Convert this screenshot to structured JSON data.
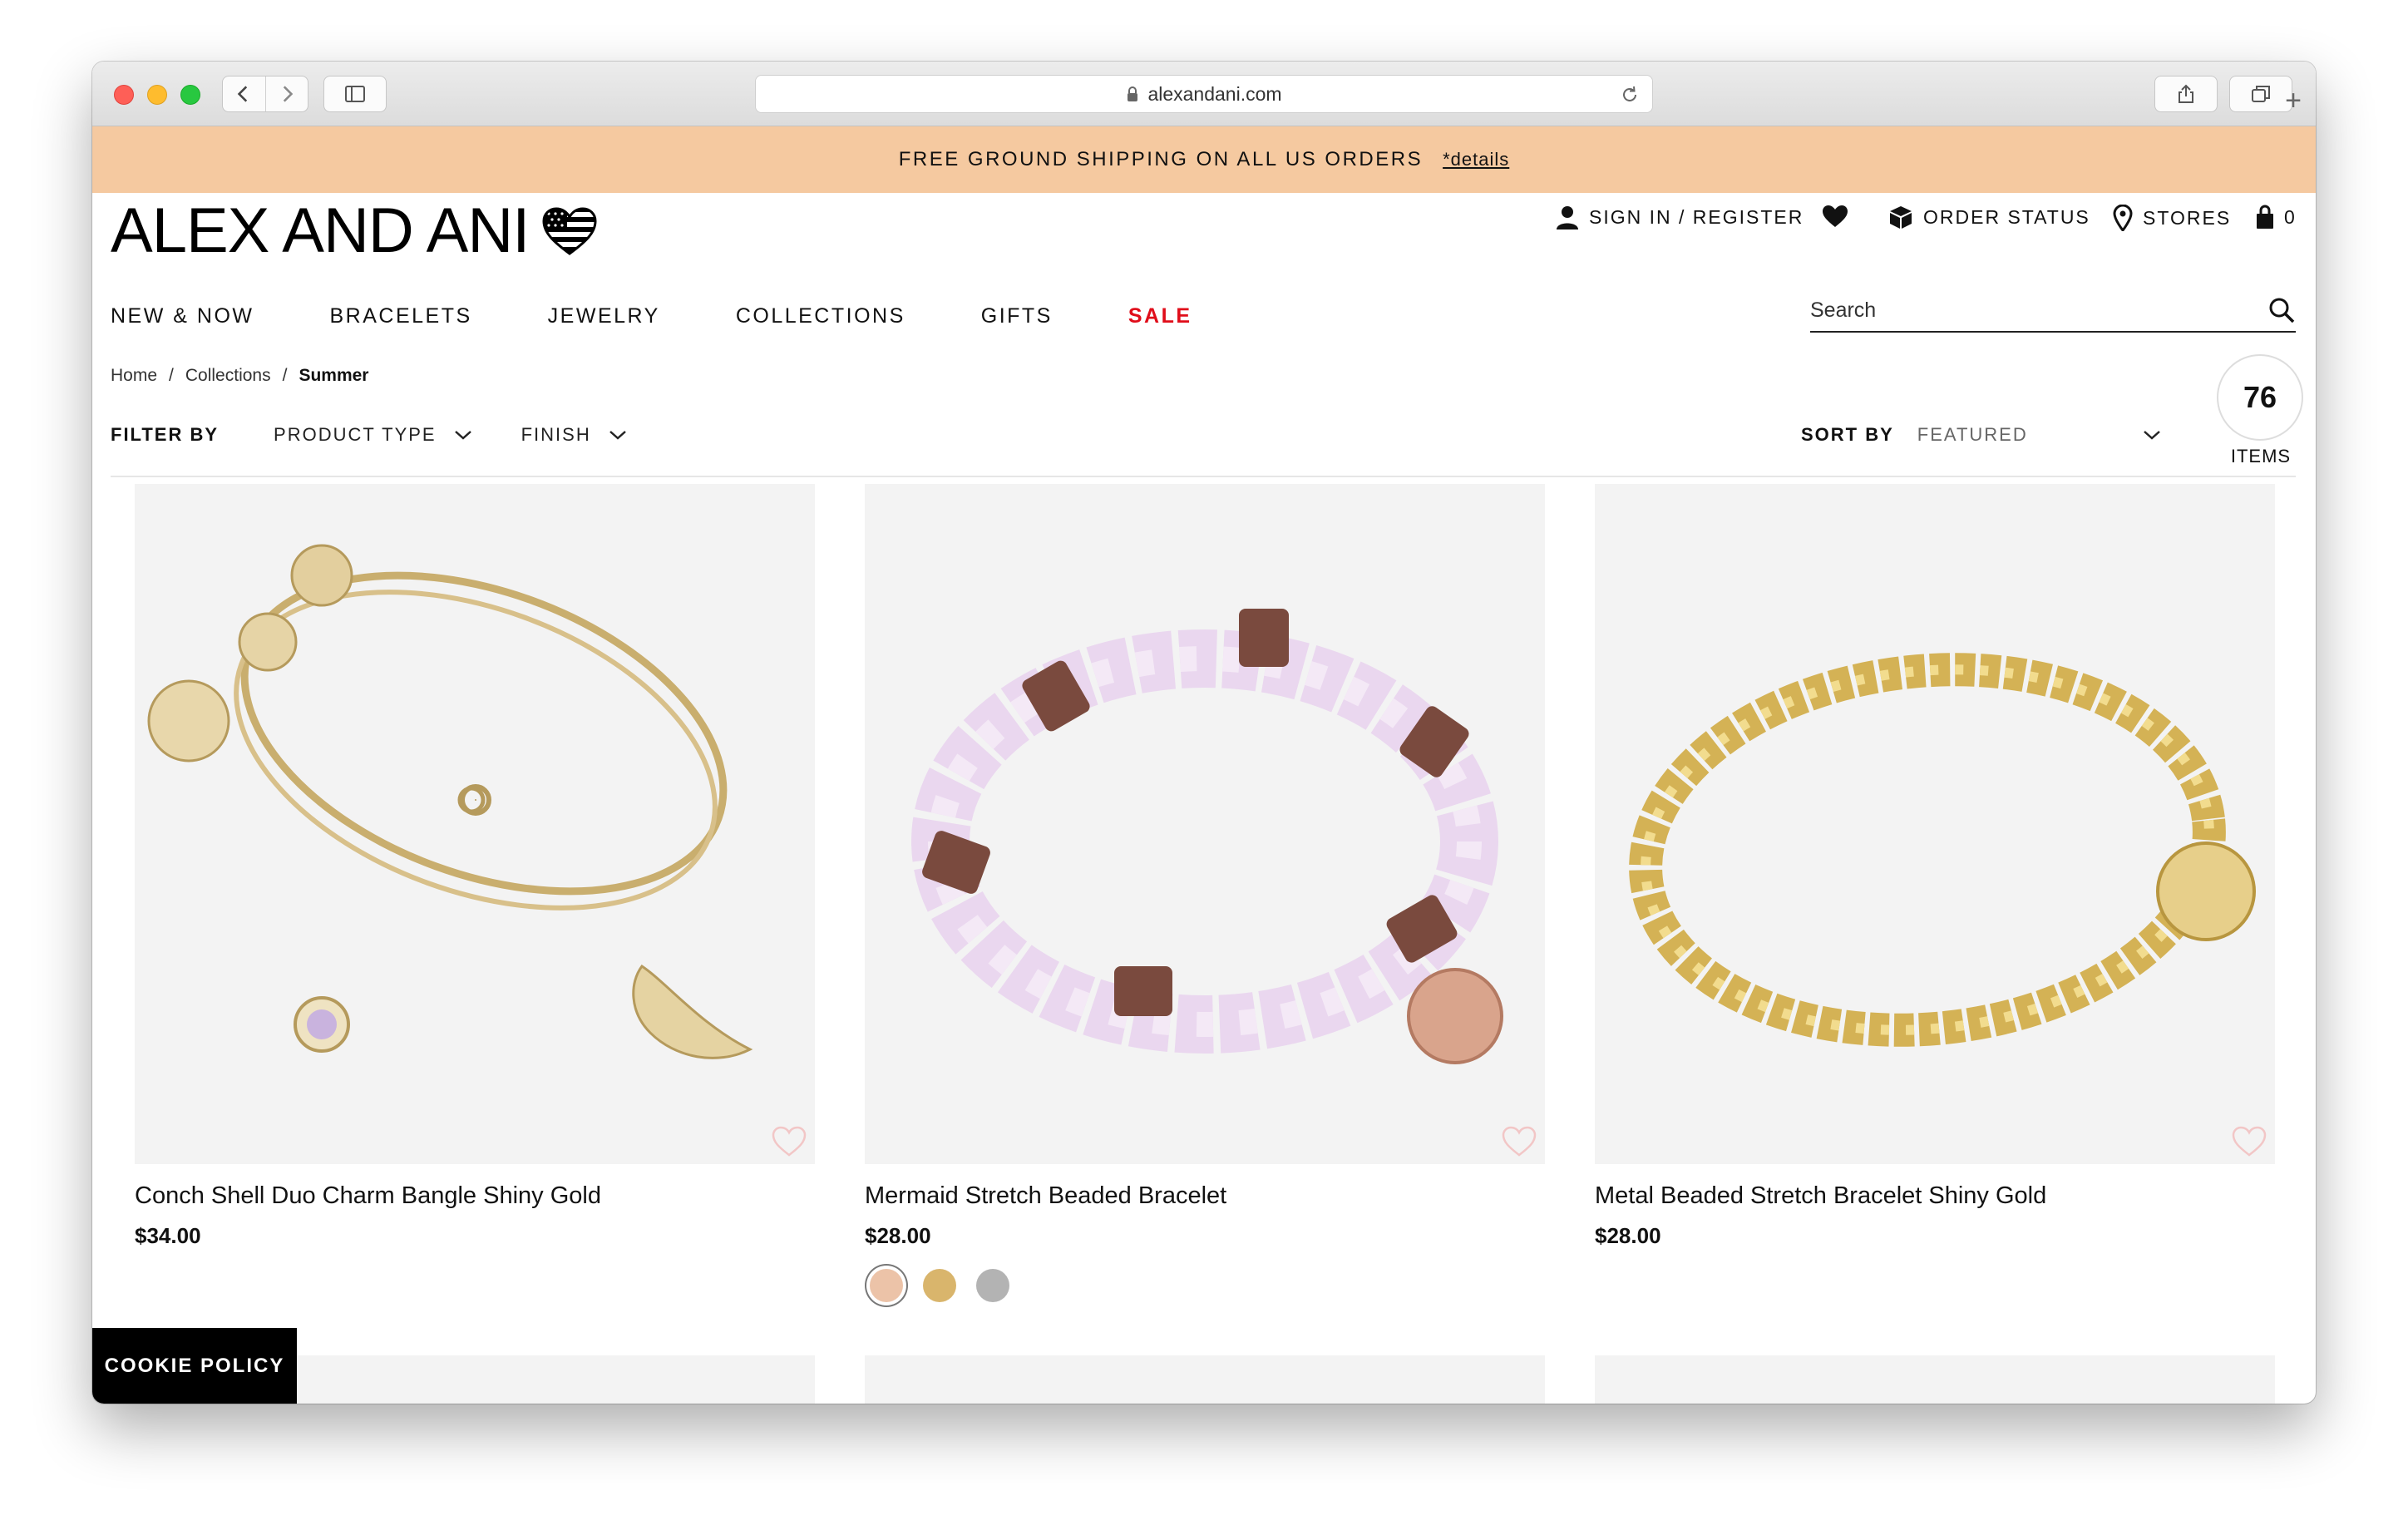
{
  "browser": {
    "url": "alexandani.com",
    "new_tab_glyph": "+"
  },
  "promo": {
    "text": "FREE GROUND SHIPPING ON ALL US ORDERS",
    "link": "*details"
  },
  "header": {
    "logo": "ALEX AND ANI",
    "sign_in": "SIGN IN / REGISTER",
    "order_status": "ORDER STATUS",
    "stores": "STORES",
    "bag_count": "0",
    "search_placeholder": "Search"
  },
  "nav": {
    "items": [
      "NEW & NOW",
      "BRACELETS",
      "JEWELRY",
      "COLLECTIONS",
      "GIFTS",
      "SALE"
    ],
    "sale_color": "#e00d1a"
  },
  "breadcrumb": {
    "items": [
      "Home",
      "Collections",
      "Summer"
    ],
    "separator": "/"
  },
  "filters": {
    "label": "FILTER BY",
    "product_type": "PRODUCT TYPE",
    "finish": "FINISH"
  },
  "sort": {
    "label": "SORT BY",
    "value": "FEATURED"
  },
  "results": {
    "count": "76",
    "label": "ITEMS"
  },
  "products": [
    {
      "name": "Conch Shell Duo Charm Bangle Shiny Gold",
      "price": "$34.00"
    },
    {
      "name": "Mermaid Stretch Beaded Bracelet",
      "price": "$28.00",
      "swatches": [
        "#ecc3a8",
        "#d9b56c",
        "#b3b3b3"
      ]
    },
    {
      "name": "Metal Beaded Stretch Bracelet Shiny Gold",
      "price": "$28.00"
    }
  ],
  "cookie": {
    "label": "COOKIE POLICY"
  },
  "colors": {
    "promo_bg": "#f5c9a0",
    "accent_sale": "#e00d1a",
    "image_bg": "#f3f3f3",
    "wishlist_outline": "#f2c6c6"
  },
  "icons": [
    "lock-icon",
    "reload-icon",
    "back-icon",
    "forward-icon",
    "sidebar-icon",
    "share-icon",
    "tabs-icon",
    "user-icon",
    "heart-icon",
    "box-icon",
    "location-pin-icon",
    "bag-icon",
    "search-icon",
    "chevron-down-icon",
    "wishlist-heart-icon",
    "flag-heart-icon"
  ]
}
